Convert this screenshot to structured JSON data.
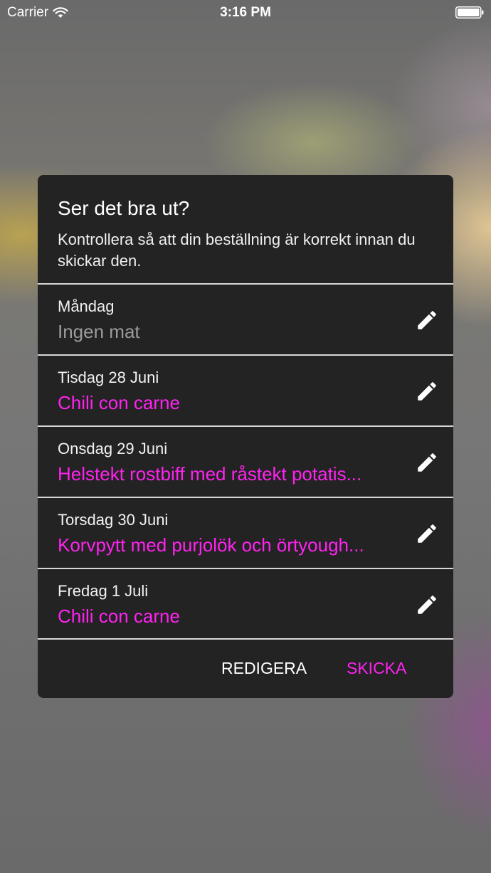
{
  "status_bar": {
    "carrier": "Carrier",
    "time": "3:16 PM"
  },
  "dialog": {
    "title": "Ser det bra ut?",
    "message": "Kontrollera så att din beställning är korrekt innan du skickar den.",
    "days": [
      {
        "day": "Måndag",
        "meal": "Ingen mat",
        "has_meal": false
      },
      {
        "day": "Tisdag 28 Juni",
        "meal": "Chili con carne",
        "has_meal": true
      },
      {
        "day": "Onsdag 29 Juni",
        "meal": "Helstekt rostbiff med råstekt potatis...",
        "has_meal": true
      },
      {
        "day": "Torsdag 30 Juni",
        "meal": "Korvpytt med purjolök och örtyough...",
        "has_meal": true
      },
      {
        "day": "Fredag 1 Juli",
        "meal": "Chili con carne",
        "has_meal": true
      }
    ],
    "edit_icon": "pencil-icon",
    "actions": {
      "edit_label": "REDIGERA",
      "send_label": "SKICKA"
    }
  },
  "colors": {
    "accent": "#ff23f0",
    "dialog_background": "#232323",
    "muted_text": "#9b9b9b"
  }
}
